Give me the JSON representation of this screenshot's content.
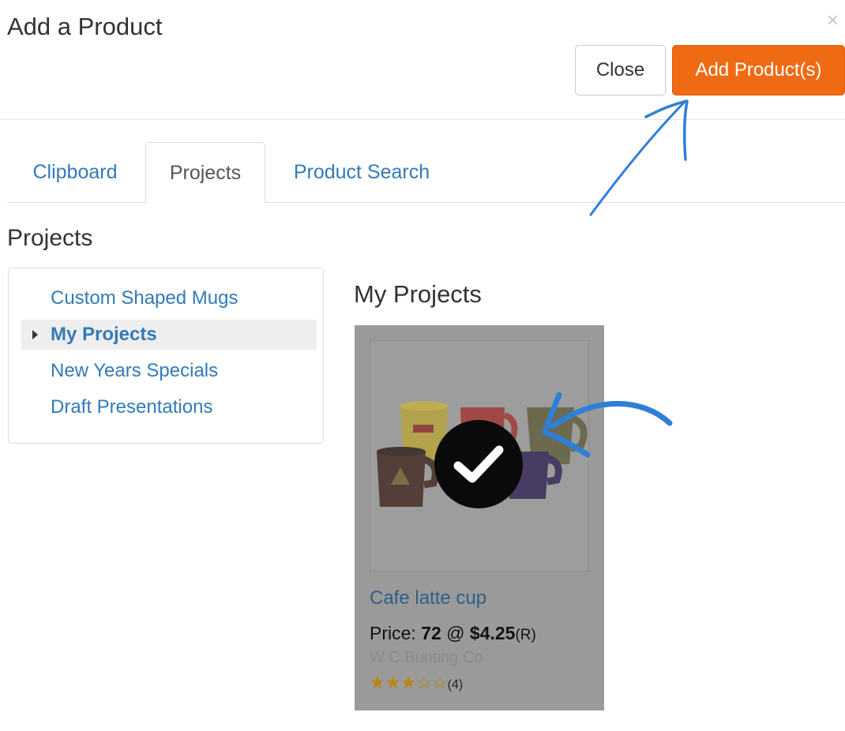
{
  "modal": {
    "title": "Add a Product",
    "close_icon_glyph": "×",
    "close_button": "Close",
    "add_button": "Add Product(s)",
    "accent_color": "#f06a14"
  },
  "tabs": [
    {
      "label": "Clipboard",
      "active": false
    },
    {
      "label": "Projects",
      "active": true
    },
    {
      "label": "Product Search",
      "active": false
    }
  ],
  "section_title": "Projects",
  "folders": [
    {
      "label": "Custom Shaped Mugs",
      "active": false
    },
    {
      "label": "My Projects",
      "active": true
    },
    {
      "label": "New Years Specials",
      "active": false
    },
    {
      "label": "Draft Presentations",
      "active": false
    }
  ],
  "projects_heading": "My Projects",
  "product": {
    "name": "Cafe latte cup",
    "price_label": "Price: ",
    "quantity": "72",
    "at": " @ ",
    "price": "$4.25",
    "price_suffix": "(R)",
    "vendor": "W C Bunting Co",
    "rating": 3,
    "rating_max": 5,
    "rating_count": "(4)",
    "selected": true,
    "image_icon": "mugs-image"
  },
  "annotations": {
    "arrow_color": "#2f7fd6"
  }
}
